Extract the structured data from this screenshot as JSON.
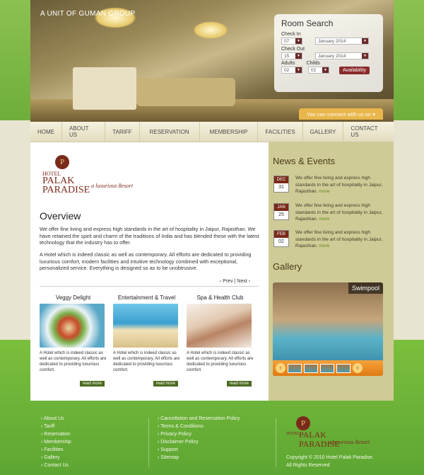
{
  "brand": {
    "unit": "A UNIT OF GUMAN GROUP",
    "hotel_small": "HOTEL",
    "hotel_name": "PALAK PARADISE",
    "tagline": "— a luxurious Resort"
  },
  "search": {
    "title": "Room Search",
    "check_in": "Check In",
    "check_out": "Check Out",
    "adults": "Adults",
    "childs": "Childs",
    "in_day": "07",
    "in_month": "January 2014",
    "out_day": "15",
    "out_month": "January 2014",
    "adults_val": "02",
    "childs_val": "02",
    "button": "Availability"
  },
  "connect": "You can connect with us on",
  "nav": [
    "HOME",
    "ABOUT US",
    "TARIFF",
    "RESERVATION",
    "MEMBERSHIP",
    "FACILITIES",
    "GALLERY",
    "CONTACT US"
  ],
  "overview": {
    "title": "Overview",
    "p1": "We offer fine living and express high standards in the art of hospitality in Jaipur, Rajasthan. We have retained the spirit and charm of the traditions of India and has blended these with the latest technology that the industry has to offer.",
    "p2": "A Hotel which is indeed classic as well as contemporary. All efforts are dedicated to providing luxurious comfort, modern facilities and intuitive technology combined with exceptional, personalized service. Everything is designed so as to be unobtrusive.",
    "prev": "Prev",
    "next": "Next"
  },
  "cards": [
    {
      "title": "Veggy Delight",
      "desc": "A Hotel which is indeed classic as well as contemporary. All efforts are dedicated to providing luxurious comfort.",
      "more": "read more"
    },
    {
      "title": "Entertainment & Travel",
      "desc": "A Hotel which is indeed classic as well as contemporary. All efforts are dedicated to providing luxurious comfort.",
      "more": "read more"
    },
    {
      "title": "Spa & Health Club",
      "desc": "A Hotel which is indeed classic as well as contemporary. All efforts are dedicated to providing luxurious comfort.",
      "more": "read more"
    }
  ],
  "news": {
    "title": "News & Events",
    "items": [
      {
        "month": "DEC",
        "day": "31",
        "text": "We offer fine living and express high standards in the art of hospitality in Jaipur, Rajasthan.",
        "more": "more"
      },
      {
        "month": "JAN",
        "day": "25",
        "text": "We offer fine living and express high standards in the art of hospitality in Jaipur, Rajasthan.",
        "more": "more"
      },
      {
        "month": "FEB",
        "day": "02",
        "text": "We offer fine living and express high standards in the art of hospitality in Jaipur, Rajasthan.",
        "more": "more"
      }
    ]
  },
  "gallery": {
    "title": "Gallery",
    "caption": "Swimpool"
  },
  "footer": {
    "col1": [
      "About Us",
      "Tariff",
      "Reservation",
      "Membership",
      "Facilities",
      "Gallery",
      "Contact Us"
    ],
    "col2": [
      "Cancellation and Reservation Policy",
      "Terms & Conditions",
      "Privacy Policy",
      "Disclaimer Policy",
      "Support",
      "Sitemap"
    ],
    "copy1": "Copyright © 2010 Hotel Palak Paradise.",
    "copy2": "All Rights Reserved"
  }
}
